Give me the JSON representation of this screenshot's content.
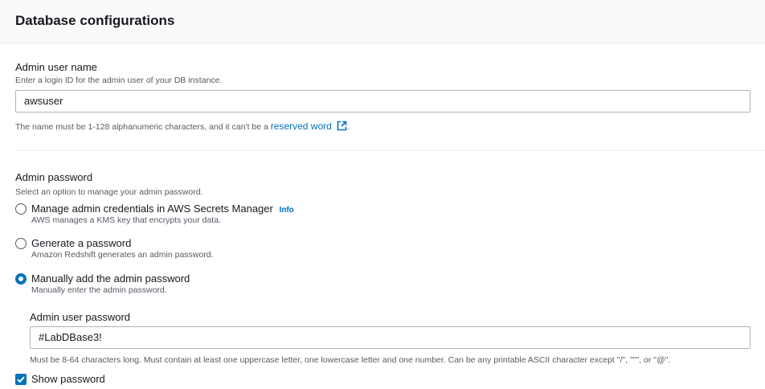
{
  "section": {
    "title": "Database configurations"
  },
  "admin_user": {
    "label": "Admin user name",
    "description": "Enter a login ID for the admin user of your DB instance.",
    "value": "awsuser",
    "hint_prefix": "The name must be 1-128 alphanumeric characters, and it can't be a",
    "hint_link": "reserved word",
    "hint_suffix": "."
  },
  "admin_password": {
    "label": "Admin password",
    "description": "Select an option to manage your admin password.",
    "options": [
      {
        "label": "Manage admin credentials in AWS Secrets Manager",
        "info": "Info",
        "description": "AWS manages a KMS key that encrypts your data.",
        "selected": false
      },
      {
        "label": "Generate a password",
        "description": "Amazon Redshift generates an admin password.",
        "selected": false
      },
      {
        "label": "Manually add the admin password",
        "description": "Manually enter the admin password.",
        "selected": true
      }
    ],
    "password_field": {
      "label": "Admin user password",
      "value": "#LabDBase3!",
      "hint": "Must be 8-64 characters long. Must contain at least one uppercase letter, one lowercase letter and one number. Can be any printable ASCII character except \"/\", \"\"\", or \"@\"."
    },
    "show_password": {
      "label": "Show password",
      "checked": true
    }
  },
  "colors": {
    "accent": "#0073bb",
    "text": "#16191f",
    "muted": "#545b64",
    "border": "#aab7b8"
  },
  "icons": {
    "external_link": "external-link-icon",
    "checkmark": "checkmark-icon"
  }
}
